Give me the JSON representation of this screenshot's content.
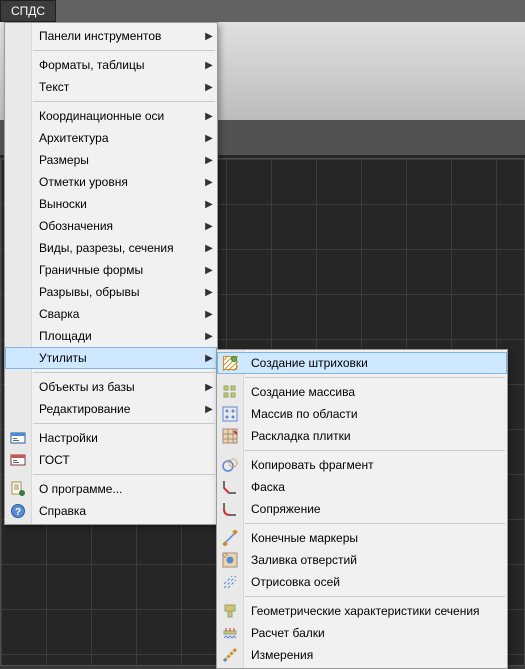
{
  "menubar": {
    "title": "СПДС"
  },
  "main_menu": {
    "items": [
      {
        "label": "Панели инструментов",
        "sub": true
      },
      {
        "sep": true
      },
      {
        "label": "Форматы, таблицы",
        "sub": true
      },
      {
        "label": "Текст",
        "sub": true
      },
      {
        "sep": true
      },
      {
        "label": "Координационные оси",
        "sub": true
      },
      {
        "label": "Архитектура",
        "sub": true
      },
      {
        "label": "Размеры",
        "sub": true
      },
      {
        "label": "Отметки уровня",
        "sub": true
      },
      {
        "label": "Выноски",
        "sub": true
      },
      {
        "label": "Обозначения",
        "sub": true
      },
      {
        "label": "Виды, разрезы, сечения",
        "sub": true
      },
      {
        "label": "Граничные формы",
        "sub": true
      },
      {
        "label": "Разрывы, обрывы",
        "sub": true
      },
      {
        "label": "Сварка",
        "sub": true
      },
      {
        "label": "Площади",
        "sub": true
      },
      {
        "label": "Утилиты",
        "sub": true,
        "hov": true
      },
      {
        "sep": true
      },
      {
        "label": "Объекты из базы",
        "sub": true
      },
      {
        "label": "Редактирование",
        "sub": true
      },
      {
        "sep": true
      },
      {
        "label": "Настройки",
        "icon": "settings"
      },
      {
        "label": "ГОСТ",
        "icon": "gost"
      },
      {
        "sep": true
      },
      {
        "label": "О программе...",
        "icon": "about"
      },
      {
        "label": "Справка",
        "icon": "help"
      }
    ]
  },
  "sub_menu": {
    "items": [
      {
        "label": "Создание штриховки",
        "icon": "hatch",
        "hov": true
      },
      {
        "sep": true
      },
      {
        "label": "Создание массива",
        "icon": "array"
      },
      {
        "label": "Массив по области",
        "icon": "array-area"
      },
      {
        "label": "Раскладка плитки",
        "icon": "tile"
      },
      {
        "sep": true
      },
      {
        "label": "Копировать фрагмент",
        "icon": "copy-frag"
      },
      {
        "label": "Фаска",
        "icon": "chamfer"
      },
      {
        "label": "Сопряжение",
        "icon": "fillet"
      },
      {
        "sep": true
      },
      {
        "label": "Конечные маркеры",
        "icon": "endmark"
      },
      {
        "label": "Заливка отверстий",
        "icon": "holefill"
      },
      {
        "label": "Отрисовка осей",
        "icon": "axes"
      },
      {
        "sep": true
      },
      {
        "label": "Геометрические характеристики сечения",
        "icon": "section"
      },
      {
        "label": "Расчет балки",
        "icon": "beam"
      },
      {
        "label": "Измерения",
        "icon": "measure"
      }
    ]
  }
}
